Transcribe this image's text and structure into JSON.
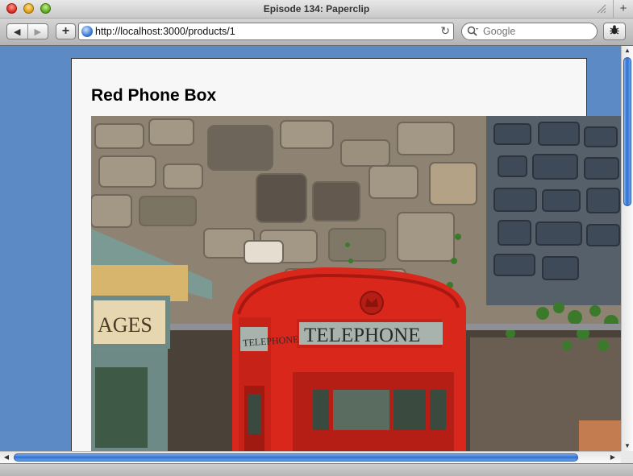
{
  "window": {
    "title": "Episode 134: Paperclip"
  },
  "toolbar": {
    "back_glyph": "◀",
    "forward_glyph": "▶",
    "add_glyph": "+",
    "address": "http://localhost:3000/products/1",
    "reload_glyph": "↻",
    "search_placeholder": "Google"
  },
  "page": {
    "product_title": "Red Phone Box",
    "image_sign_text": "TELEPHONE",
    "image_side_sign_text": "TELEPHONE",
    "image_shop_sign_text": "AGES"
  },
  "icons": {
    "back": "left-arrow",
    "forward": "right-arrow",
    "add": "plus",
    "site": "globe",
    "reload": "reload",
    "search": "magnifier",
    "bug": "bug",
    "newtab": "plus"
  },
  "colors": {
    "page_background": "#5c8ac4",
    "phonebox_red": "#d9271c",
    "sign_background": "#a8b3ad"
  }
}
